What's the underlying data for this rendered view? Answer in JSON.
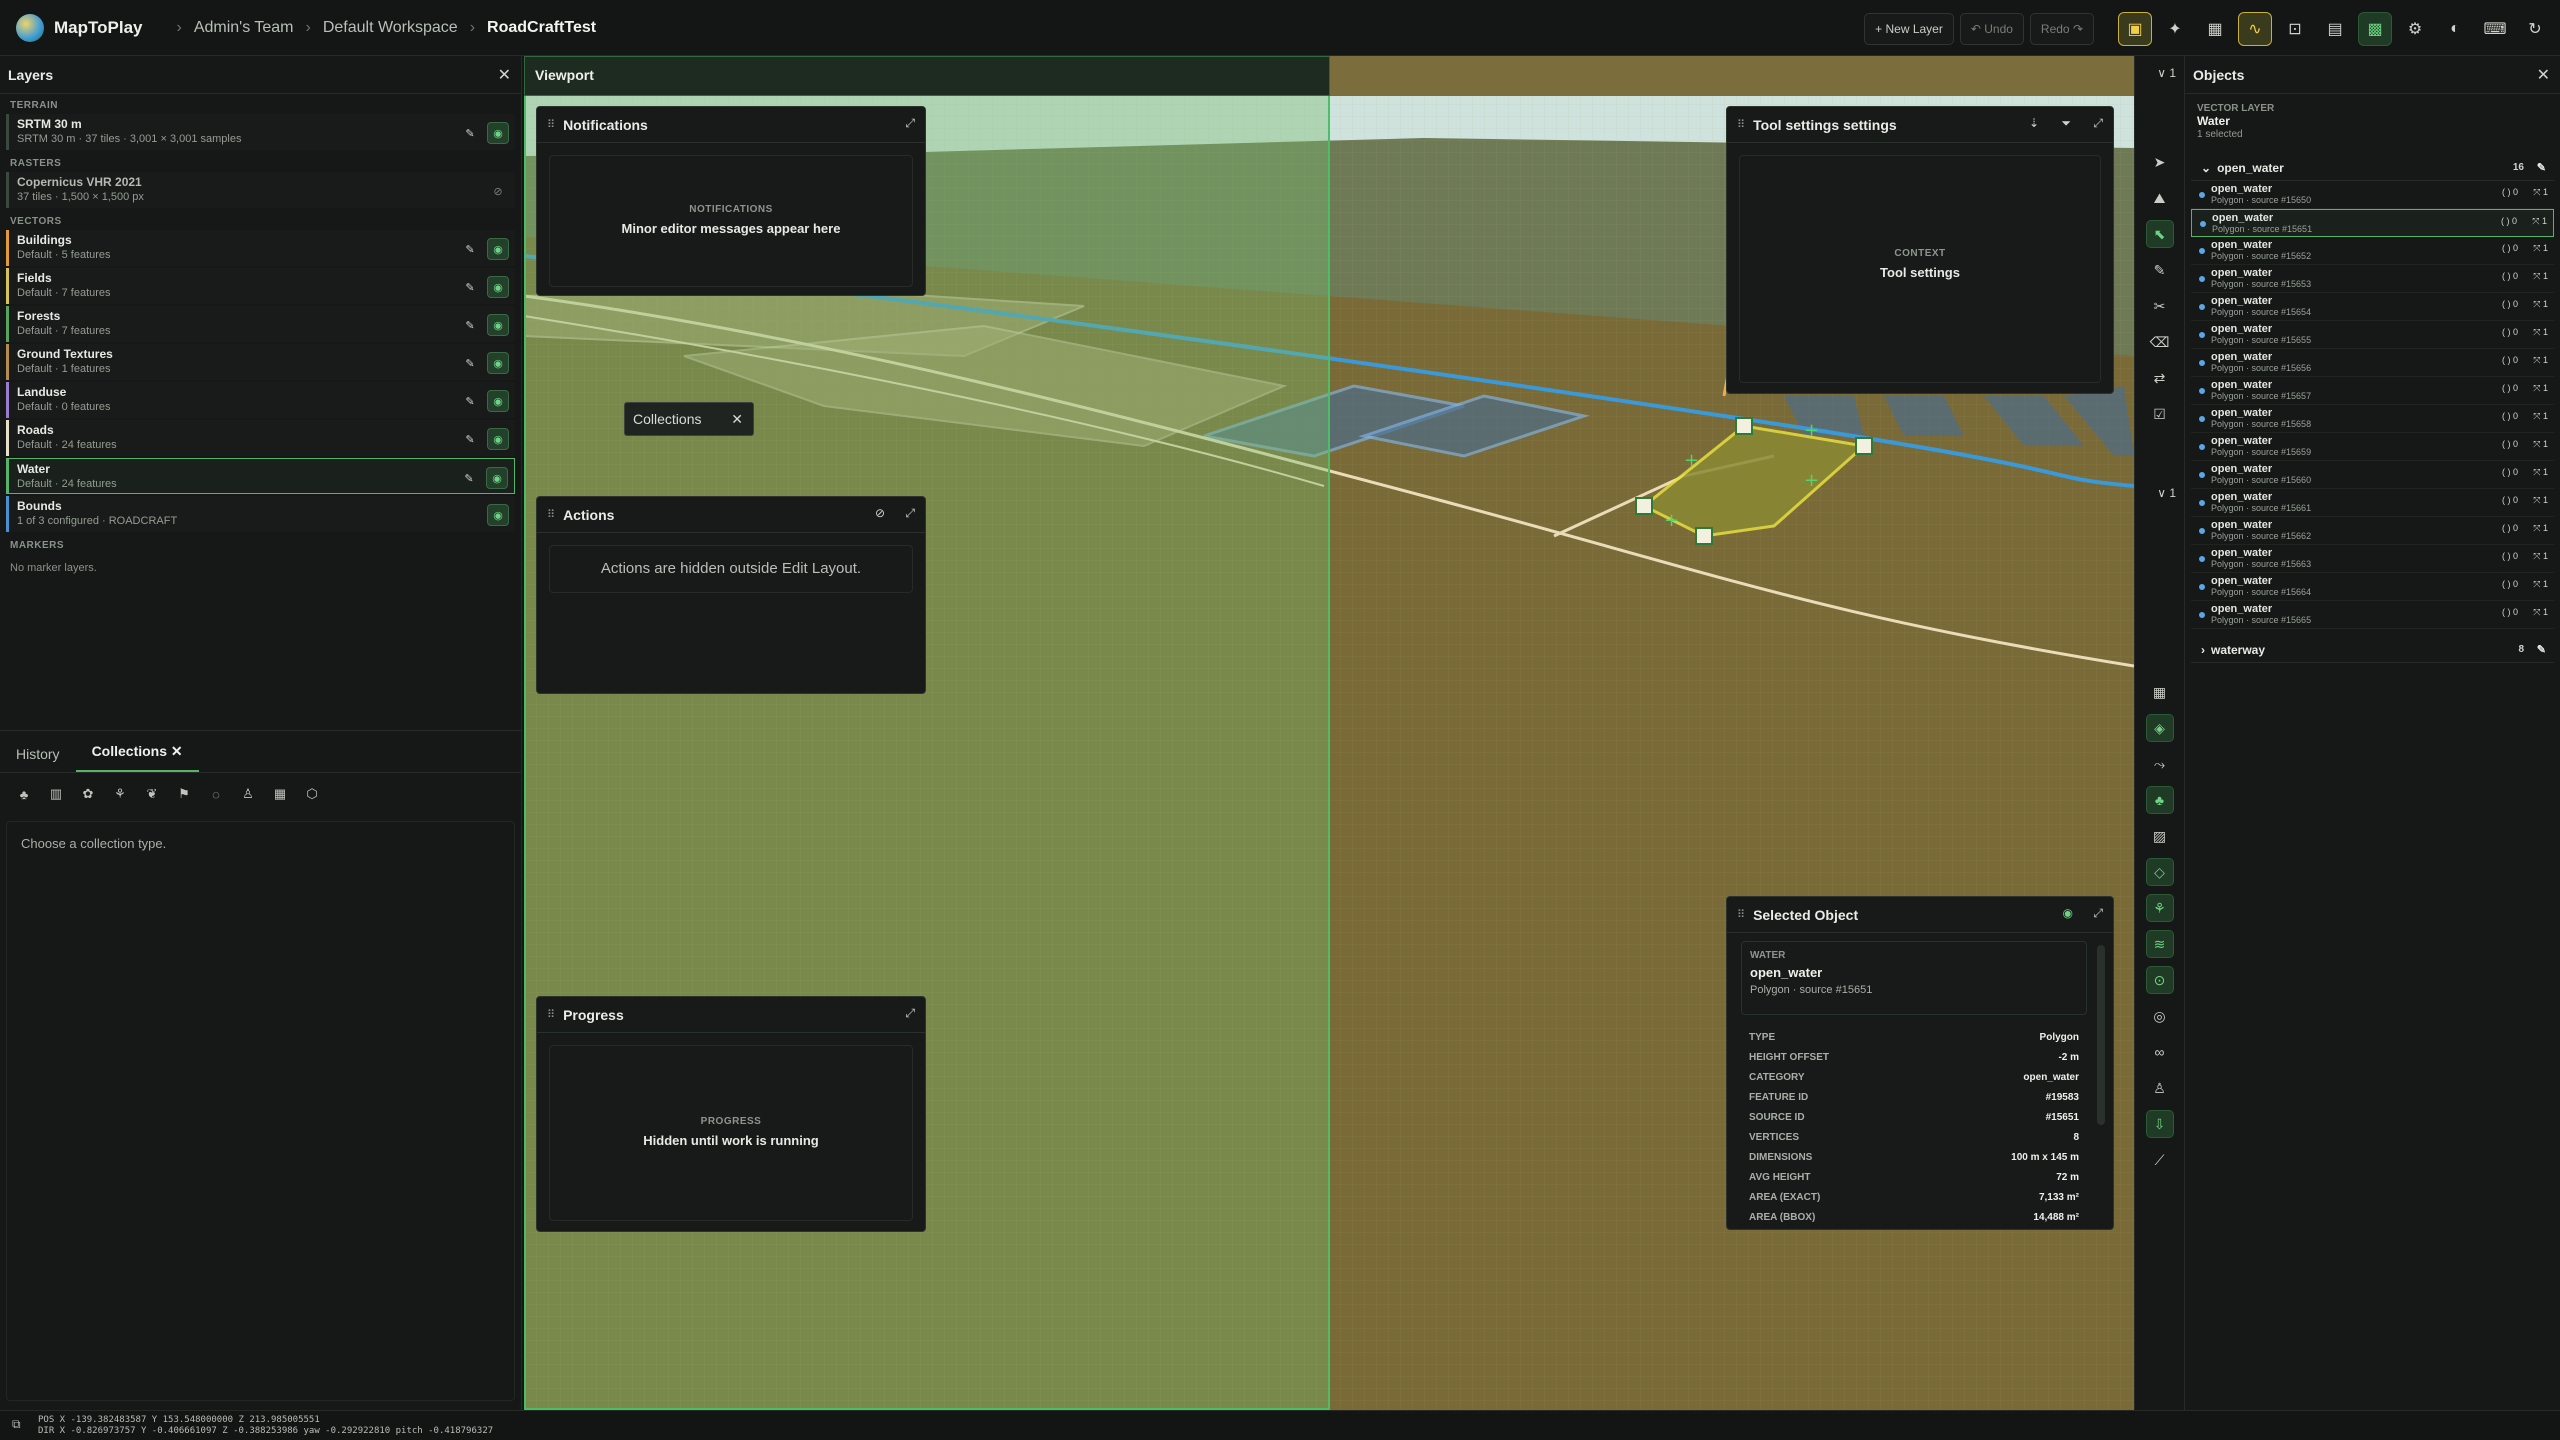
{
  "topbar": {
    "app_name": "MapToPlay",
    "breadcrumbs": [
      "Admin's Team",
      "Default Workspace",
      "RoadCraftTest"
    ],
    "new_layer": "+ New Layer",
    "undo": "↶ Undo",
    "redo": "Redo ↷"
  },
  "layers_panel": {
    "title": "Layers",
    "groups": {
      "terrain": "TERRAIN",
      "rasters": "RASTERS",
      "vectors": "VECTORS",
      "markers": "MARKERS"
    },
    "terrain_items": [
      {
        "name": "SRTM 30 m",
        "sub": "SRTM 30 m · 37 tiles · 3,001 × 3,001 samples"
      }
    ],
    "raster_items": [
      {
        "name": "Copernicus VHR 2021",
        "sub": "37 tiles · 1,500 × 1,500 px"
      }
    ],
    "vector_items": [
      {
        "name": "Buildings",
        "sub": "Default · 5 features"
      },
      {
        "name": "Fields",
        "sub": "Default · 7 features"
      },
      {
        "name": "Forests",
        "sub": "Default · 7 features"
      },
      {
        "name": "Ground Textures",
        "sub": "Default · 1 features"
      },
      {
        "name": "Landuse",
        "sub": "Default · 0 features"
      },
      {
        "name": "Roads",
        "sub": "Default · 24 features"
      },
      {
        "name": "Water",
        "sub": "Default · 24 features"
      },
      {
        "name": "Bounds",
        "sub": "1 of 3 configured · ROADCRAFT"
      }
    ],
    "no_markers": "No marker layers."
  },
  "bottom_panel": {
    "tabs": [
      "History",
      "Collections"
    ],
    "active_tab": "Collections",
    "placeholder": "Choose a collection type."
  },
  "viewport": {
    "title": "Viewport",
    "collections_chip": "Collections"
  },
  "notifications": {
    "title": "Notifications",
    "kicker": "NOTIFICATIONS",
    "message": "Minor editor messages appear here"
  },
  "actions": {
    "title": "Actions",
    "message": "Actions are hidden outside Edit Layout."
  },
  "progress": {
    "title": "Progress",
    "kicker": "PROGRESS",
    "message": "Hidden until work is running"
  },
  "tool_settings": {
    "title": "Tool settings settings",
    "kicker": "CONTEXT",
    "message": "Tool settings"
  },
  "selected_object": {
    "title": "Selected Object",
    "layer": "WATER",
    "name": "open_water",
    "sub": "Polygon · source #15651",
    "props": [
      {
        "k": "TYPE",
        "v": "Polygon"
      },
      {
        "k": "HEIGHT OFFSET",
        "v": "-2 m"
      },
      {
        "k": "CATEGORY",
        "v": "open_water"
      },
      {
        "k": "FEATURE ID",
        "v": "#19583"
      },
      {
        "k": "SOURCE ID",
        "v": "#15651"
      },
      {
        "k": "VERTICES",
        "v": "8"
      },
      {
        "k": "DIMENSIONS",
        "v": "100 m x 145 m"
      },
      {
        "k": "AVG HEIGHT",
        "v": "72 m"
      },
      {
        "k": "AREA (EXACT)",
        "v": "7,133 m²"
      },
      {
        "k": "AREA (BBOX)",
        "v": "14,488 m²"
      }
    ]
  },
  "objects_panel": {
    "title": "Objects",
    "kicker": "VECTOR LAYER",
    "layer": "Water",
    "selected": "1 selected",
    "group_open": {
      "name": "open_water",
      "count": "16"
    },
    "group_closed": {
      "name": "waterway",
      "count": "8"
    },
    "items": [
      {
        "name": "open_water",
        "sub": "Polygon · source #15650"
      },
      {
        "name": "open_water",
        "sub": "Polygon · source #15651"
      },
      {
        "name": "open_water",
        "sub": "Polygon · source #15652"
      },
      {
        "name": "open_water",
        "sub": "Polygon · source #15653"
      },
      {
        "name": "open_water",
        "sub": "Polygon · source #15654"
      },
      {
        "name": "open_water",
        "sub": "Polygon · source #15655"
      },
      {
        "name": "open_water",
        "sub": "Polygon · source #15656"
      },
      {
        "name": "open_water",
        "sub": "Polygon · source #15657"
      },
      {
        "name": "open_water",
        "sub": "Polygon · source #15658"
      },
      {
        "name": "open_water",
        "sub": "Polygon · source #15659"
      },
      {
        "name": "open_water",
        "sub": "Polygon · source #15660"
      },
      {
        "name": "open_water",
        "sub": "Polygon · source #15661"
      },
      {
        "name": "open_water",
        "sub": "Polygon · source #15662"
      },
      {
        "name": "open_water",
        "sub": "Polygon · source #15663"
      },
      {
        "name": "open_water",
        "sub": "Polygon · source #15664"
      },
      {
        "name": "open_water",
        "sub": "Polygon · source #15665"
      }
    ],
    "badge_a": "( ) 0",
    "badge_b": "⤧ 1"
  },
  "rail": {
    "top_count": "∨ 1",
    "mid_count": "∨ 1"
  },
  "status": {
    "pos": "POS X -139.382483587 Y 153.548000000 Z 213.985005551",
    "dir": "DIR X -0.826973757 Y -0.406661097 Z -0.388253986 yaw -0.292922810 pitch -0.418796327"
  },
  "colors": {
    "accent": "#58b36a",
    "highlight": "#f0d04a",
    "water": "#5aa6e6"
  }
}
